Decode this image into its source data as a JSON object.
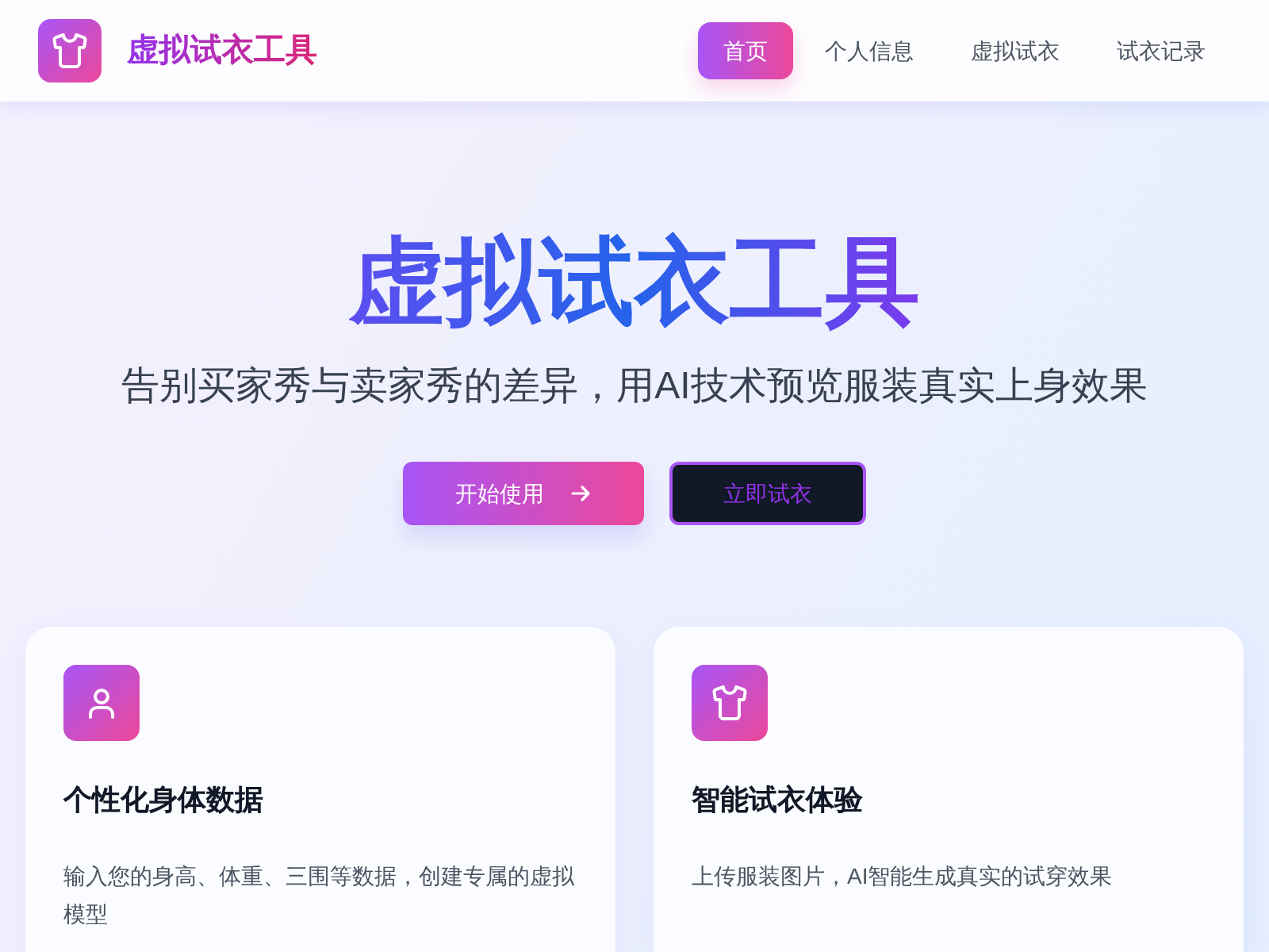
{
  "header": {
    "logo_title": "虚拟试衣工具",
    "nav": [
      {
        "label": "首页",
        "selected": true
      },
      {
        "label": "个人信息",
        "selected": false
      },
      {
        "label": "虚拟试衣",
        "selected": false
      },
      {
        "label": "试衣记录",
        "selected": false
      }
    ]
  },
  "hero": {
    "title": "虚拟试衣工具",
    "subtitle": "告别买家秀与卖家秀的差异，用AI技术预览服装真实上身效果",
    "buttons": [
      {
        "label": "开始使用",
        "kind": "primary"
      },
      {
        "label": "立即试衣",
        "kind": "outline"
      }
    ]
  },
  "features": [
    {
      "title": "个性化身体数据",
      "description": "输入您的身高、体重、三围等数据，创建专属的虚拟模型"
    },
    {
      "title": "智能试衣体验",
      "description": "上传服装图片，AI智能生成真实的试穿效果"
    }
  ]
}
